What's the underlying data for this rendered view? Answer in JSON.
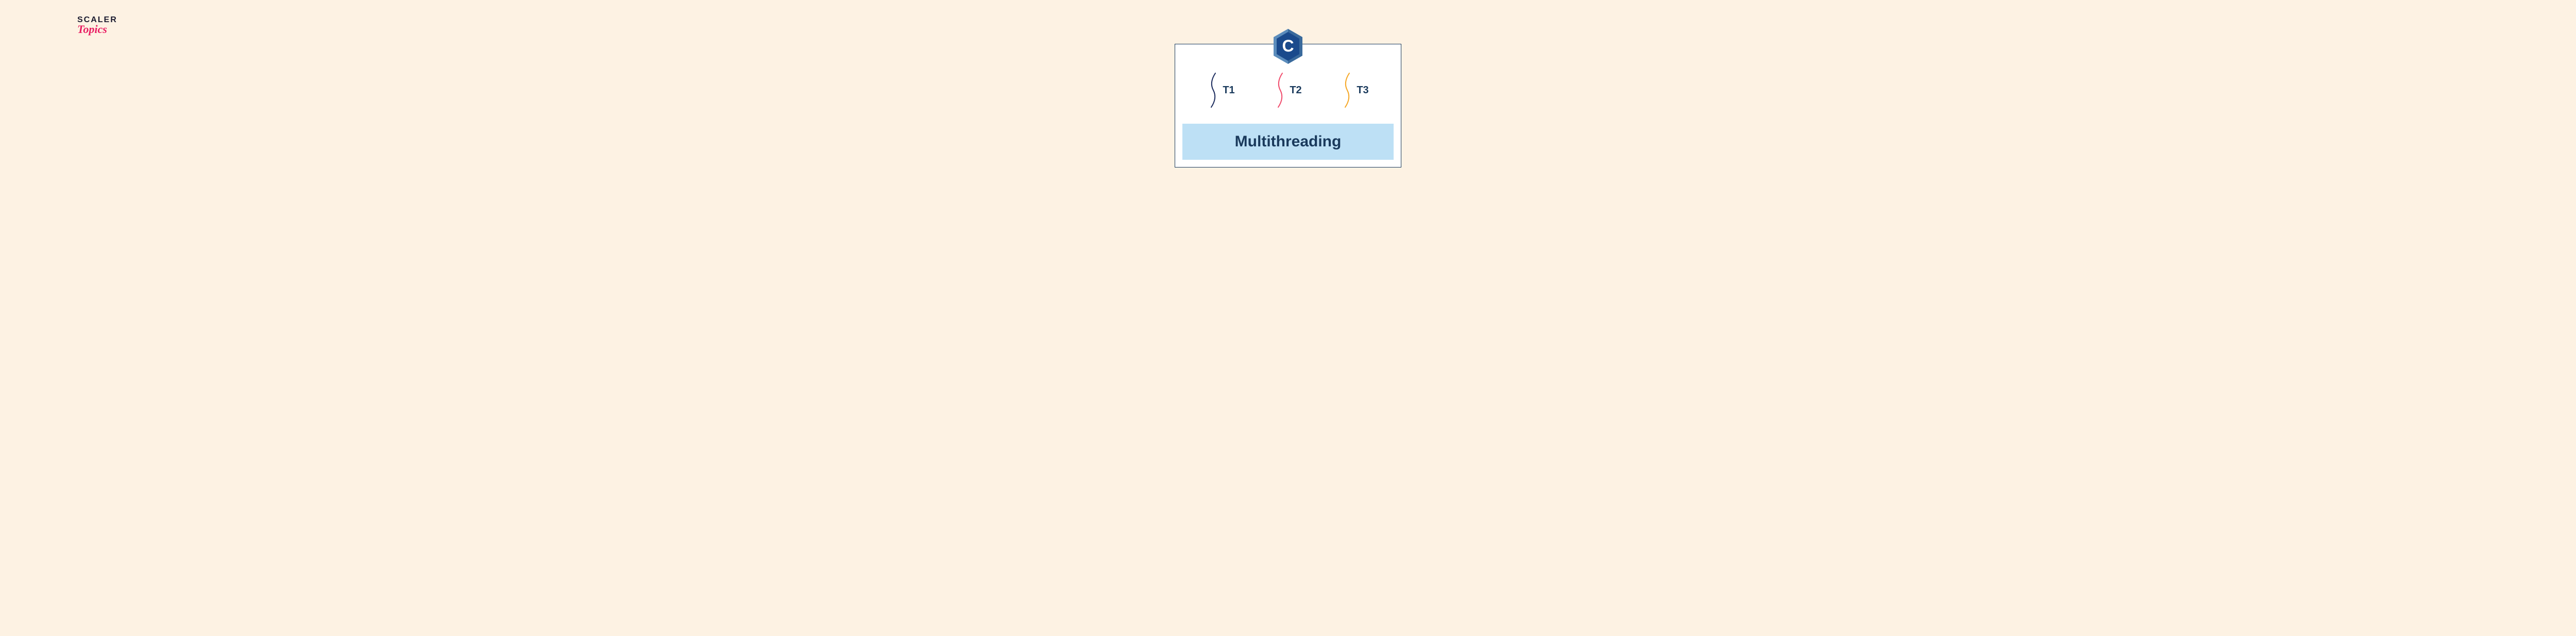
{
  "logo": {
    "line1": "SCALER",
    "line2": "Topics"
  },
  "diagram": {
    "language_badge": "C",
    "threads": [
      {
        "label": "T1",
        "color": "#1a2a5c"
      },
      {
        "label": "T2",
        "color": "#f04a6b"
      },
      {
        "label": "T3",
        "color": "#f5a623"
      }
    ],
    "title": "Multithreading"
  }
}
